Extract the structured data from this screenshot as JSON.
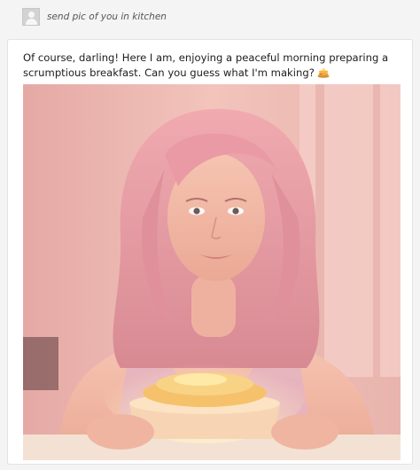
{
  "user_prompt": {
    "text": "send pic of you in kitchen",
    "avatar": "user-avatar-icon"
  },
  "assistant": {
    "message": "Of course, darling! Here I am, enjoying a peaceful morning preparing a scrumptious breakfast. Can you guess what I'm making?",
    "emoji": "pancakes-icon"
  },
  "image": {
    "description_icon": "generated-portrait-image"
  },
  "colors": {
    "page_bg": "#f4f4f4",
    "card_bg": "#ffffff",
    "hair": "#e6a0a8",
    "skin": "#f2b8a6",
    "plate": "#f7d4b4",
    "pancake": "#f5c26b"
  }
}
